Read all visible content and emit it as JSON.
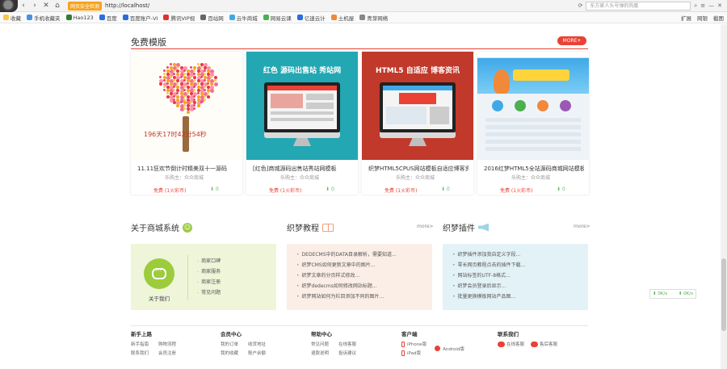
{
  "browser": {
    "address_tag": "网页安全检测",
    "url": "http://localhost/",
    "search_placeholder": "东方家人头号弹的热度",
    "bookmarks": [
      "收藏",
      "手机收藏夹",
      "Hao123",
      "百度",
      "百度账户-VI",
      "腾讯VIP视",
      "百站网",
      "云牛商城",
      "网易云课",
      "亿速云计",
      "土机屋",
      "青芽网络"
    ],
    "bookmarks_right": [
      "扩展",
      "网银",
      "截图"
    ]
  },
  "section": {
    "title": "免费模版",
    "more": "MORE+"
  },
  "cards": [
    {
      "title": "11.11狂欢节倒计时精美双十一源码",
      "author": "乐购主：众众商城",
      "price": "免费 (1火彩币)",
      "downloads": "0",
      "count_label": "196天17时42分54秒"
    },
    {
      "title": "[红色]商城源码出售站秀站网模板",
      "author": "乐购主：众众商城",
      "price": "免费 (1火彩币)",
      "downloads": "0",
      "head": "红色  源码出售站  秀站网"
    },
    {
      "title": "织梦HTML5CPUS网站模板自适应博客资讯",
      "author": "乐购主：众众商城",
      "price": "免费 (1火彩币)",
      "downloads": "0",
      "head": "HTML5 自适应  博客资讯"
    },
    {
      "title": "2016红梦HTML5全站源码商城网站模板",
      "author": "乐购主：众众商城",
      "price": "免费 (1火彩币)",
      "downloads": "0"
    }
  ],
  "panels": {
    "about": {
      "title": "关于商城系统",
      "label": "关于我们",
      "items": [
        "商家口碑",
        "商家服务",
        "商家注册",
        "常见问题"
      ]
    },
    "tutorials": {
      "title": "织梦教程",
      "more": "more>",
      "items": [
        "DEDECMS中的DATA目录解析，需要知道...",
        "织梦CMS如何更新文章中的图片...",
        "织梦文章的分页样式修改...",
        "织梦dedecms如何修改网站标题...",
        "织梦网站如何为栏目添加不同的图片..."
      ]
    },
    "plugins": {
      "title": "织梦插件",
      "more": "more>",
      "items": [
        "织梦插件添加我自定义字段...",
        "零长网页教程点击的插件下载...",
        "网站标签的UTF-8格式...",
        "织梦会员登录后显示...",
        "批量更换模板网站产品图..."
      ]
    }
  },
  "side_widget": {
    "left": "0K/s",
    "right": "0K/s"
  },
  "footer": {
    "col1": {
      "head": "新手上路",
      "links": [
        "新手指南",
        "购物流程",
        "联系我们",
        "会员注册"
      ]
    },
    "col2": {
      "head": "会员中心",
      "links": [
        "我的订单",
        "收货地址",
        "我的收藏",
        "账户余额"
      ]
    },
    "col3": {
      "head": "帮助中心",
      "links": [
        "常见问题",
        "在线客服",
        "退款说明",
        "投诉建议"
      ]
    },
    "col4": {
      "head": "客户端",
      "iphone": "iPhone版",
      "android": "Android版",
      "ipad": "iPad版"
    },
    "col5": {
      "head": "联系我们",
      "qq1": "在线客服",
      "qq2": "售后客服"
    }
  }
}
